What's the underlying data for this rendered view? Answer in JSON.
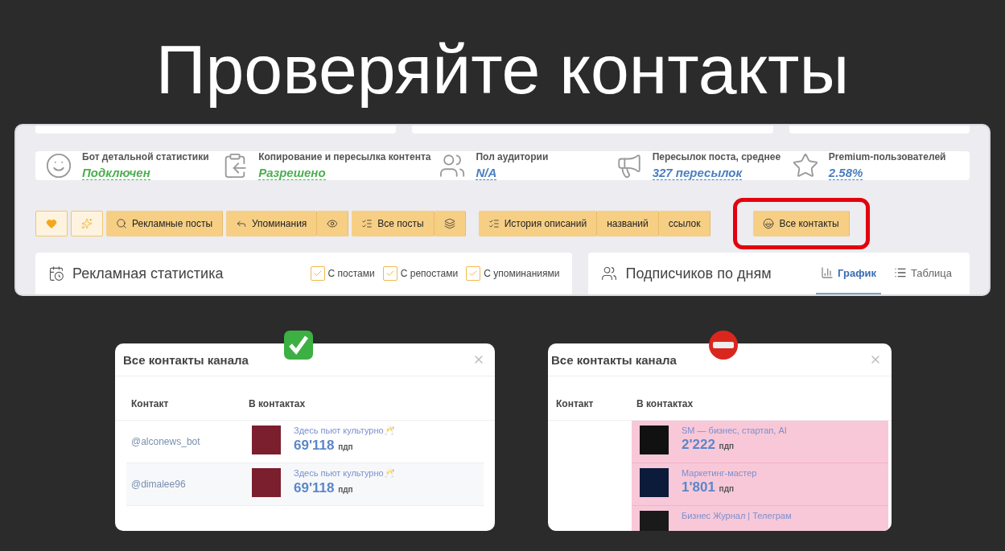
{
  "slide_title": "Проверяйте контакты",
  "stats": [
    {
      "label": "Бот детальной статистики",
      "value": "Подключен",
      "color": "#4caf50"
    },
    {
      "label": "Копирование и пересылка контента",
      "value": "Разрешено",
      "color": "#4caf50"
    },
    {
      "label": "Пол аудитории",
      "value": "N/A",
      "color": "#4a7fc1"
    },
    {
      "label": "Пересылок поста, среднее",
      "value": "327 пересылок",
      "color": "#4a7fc1"
    },
    {
      "label": "Premium-пользователей",
      "value": "2.58%",
      "color": "#4a7fc1"
    }
  ],
  "toolbar": [
    {
      "group": [
        {
          "kind": "icon"
        }
      ],
      "outlined": true
    },
    {
      "group": [
        {
          "kind": "icon"
        }
      ],
      "outlined": true
    },
    {
      "group": [
        {
          "kind": "text",
          "label": "Рекламные посты"
        }
      ],
      "outlined": false
    },
    {
      "group": [
        {
          "kind": "text",
          "label": "Упоминания"
        },
        {
          "kind": "icon"
        }
      ],
      "outlined": false
    },
    {
      "group": [
        {
          "kind": "text",
          "label": "Все посты"
        },
        {
          "kind": "icon"
        }
      ],
      "outlined": false
    },
    {
      "group": [
        {
          "kind": "text",
          "label": "История описаний"
        },
        {
          "kind": "text",
          "label": "названий"
        },
        {
          "kind": "text",
          "label": "ссылок"
        }
      ],
      "outlined": false
    },
    {
      "group": [
        {
          "kind": "text",
          "label": "Все контакты"
        }
      ],
      "outlined": false,
      "highlighted": true
    }
  ],
  "ad_stats": {
    "title": "Рекламная статистика",
    "checkboxes": [
      {
        "label": "С постами",
        "checked": true
      },
      {
        "label": "С репостами",
        "checked": true
      },
      {
        "label": "С упоминаниями",
        "checked": true
      }
    ]
  },
  "subscribers": {
    "title": "Подписчиков по дням",
    "tabs": [
      {
        "label": "График",
        "selected": true
      },
      {
        "label": "Таблица",
        "selected": false
      }
    ]
  },
  "modals": [
    {
      "kind": "approved",
      "title": "Все контакты канала",
      "columns": [
        "Контакт",
        "В контактах"
      ],
      "rows": [
        {
          "contact": "@alconews_bot",
          "channels": [
            {
              "name": "Здесь пьют культурно🥂",
              "count": "69'118",
              "unit": "пдп",
              "color": "#7b1e2e"
            }
          ]
        },
        {
          "contact": "@dimalee96",
          "channels": [
            {
              "name": "Здесь пьют культурно🥂",
              "count": "69'118",
              "unit": "пдп",
              "color": "#7b1e2e"
            }
          ]
        }
      ]
    },
    {
      "kind": "rejected",
      "title": "Все контакты канала",
      "columns": [
        "Контакт",
        "В контактах"
      ],
      "rows": [
        {
          "channels": [
            {
              "name": "SM — бизнес, стартап, AI",
              "count": "2'222",
              "unit": "пдп",
              "color": "#111111"
            },
            {
              "name": "Маркетинг-мастер",
              "count": "1'801",
              "unit": "пдп",
              "color": "#0d1b3a"
            },
            {
              "name": "Бизнес Журнал | Телеграм",
              "color": "#1a1a1a"
            }
          ]
        }
      ]
    }
  ]
}
